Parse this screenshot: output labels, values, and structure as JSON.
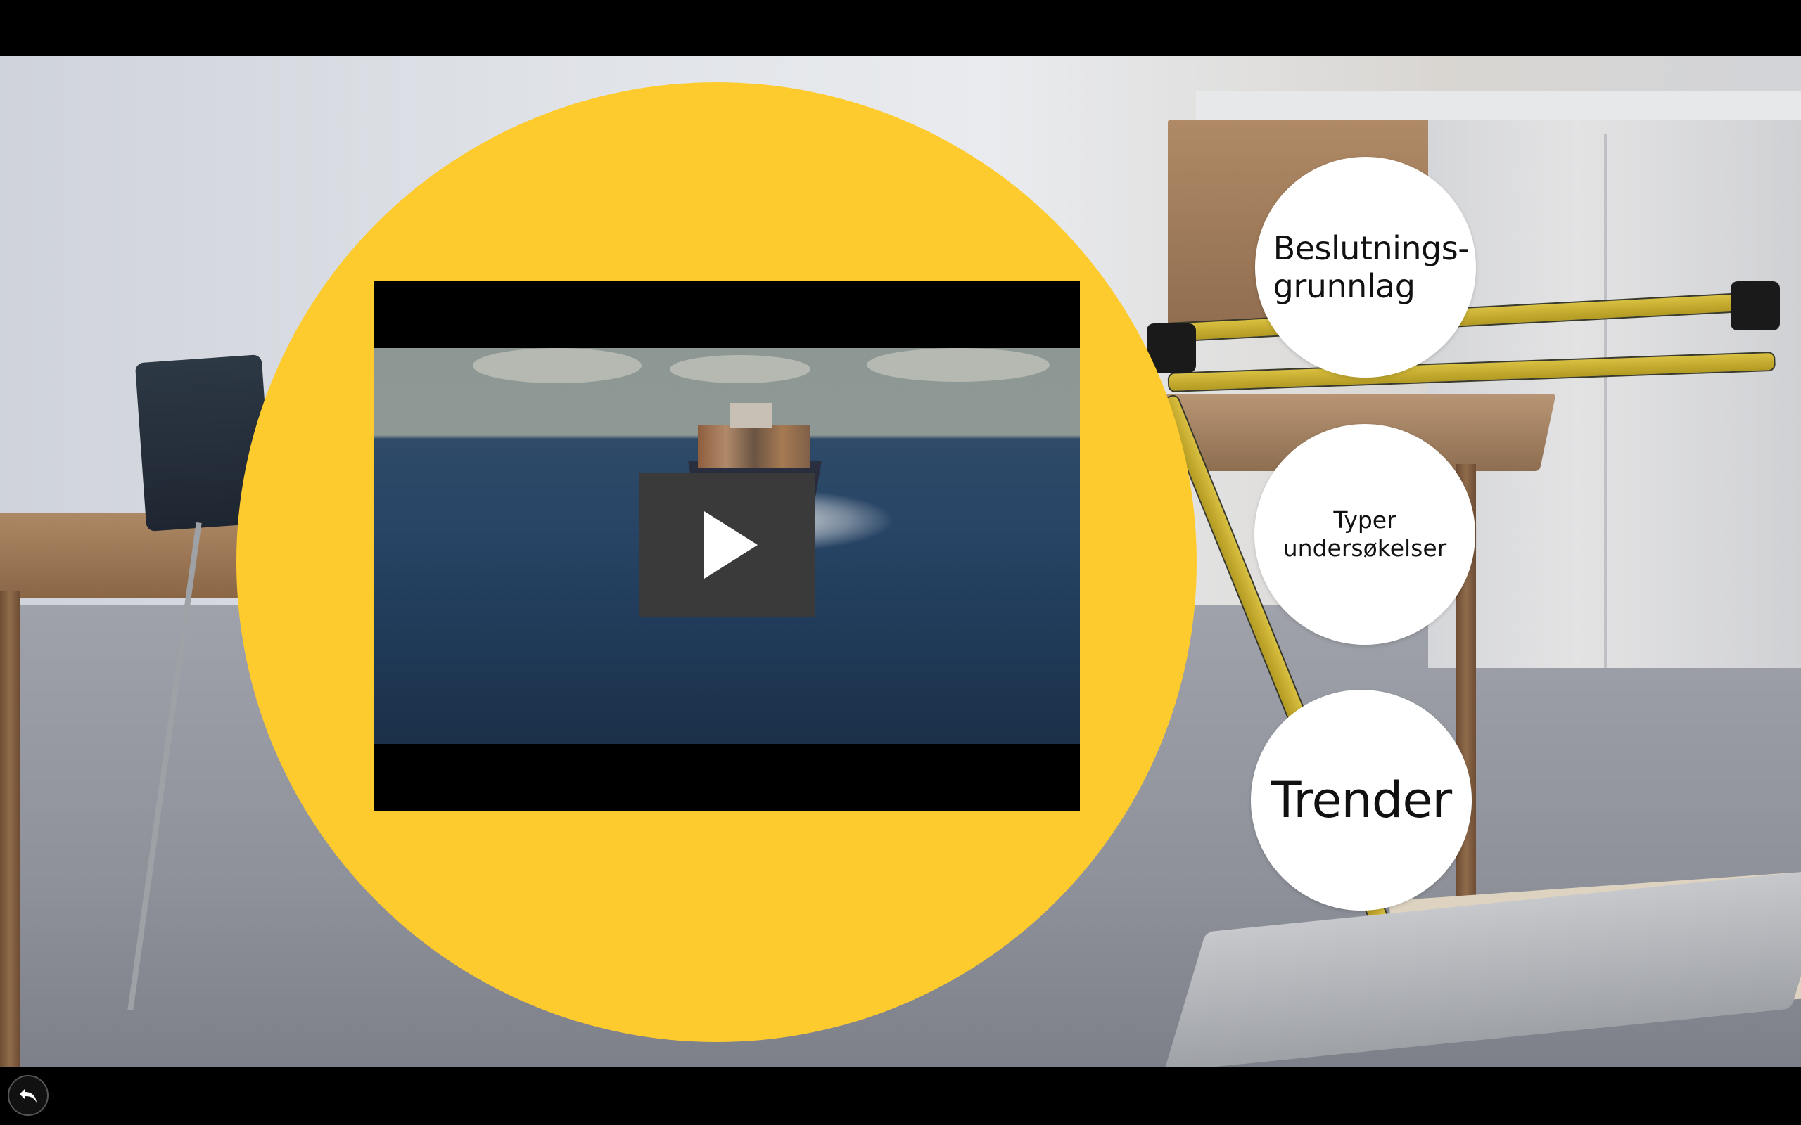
{
  "topics": {
    "item_1": "Beslutnings-grunnlag",
    "item_2": "Typer undersøkelser",
    "item_3": "Trender"
  },
  "icons": {
    "play": "play-icon",
    "back": "back-arrow-icon"
  },
  "colors": {
    "accent_circle": "#fecb2f",
    "topic_circle": "#ffffff",
    "bars": "#000000",
    "play_button_bg": "#3a3a3a"
  }
}
